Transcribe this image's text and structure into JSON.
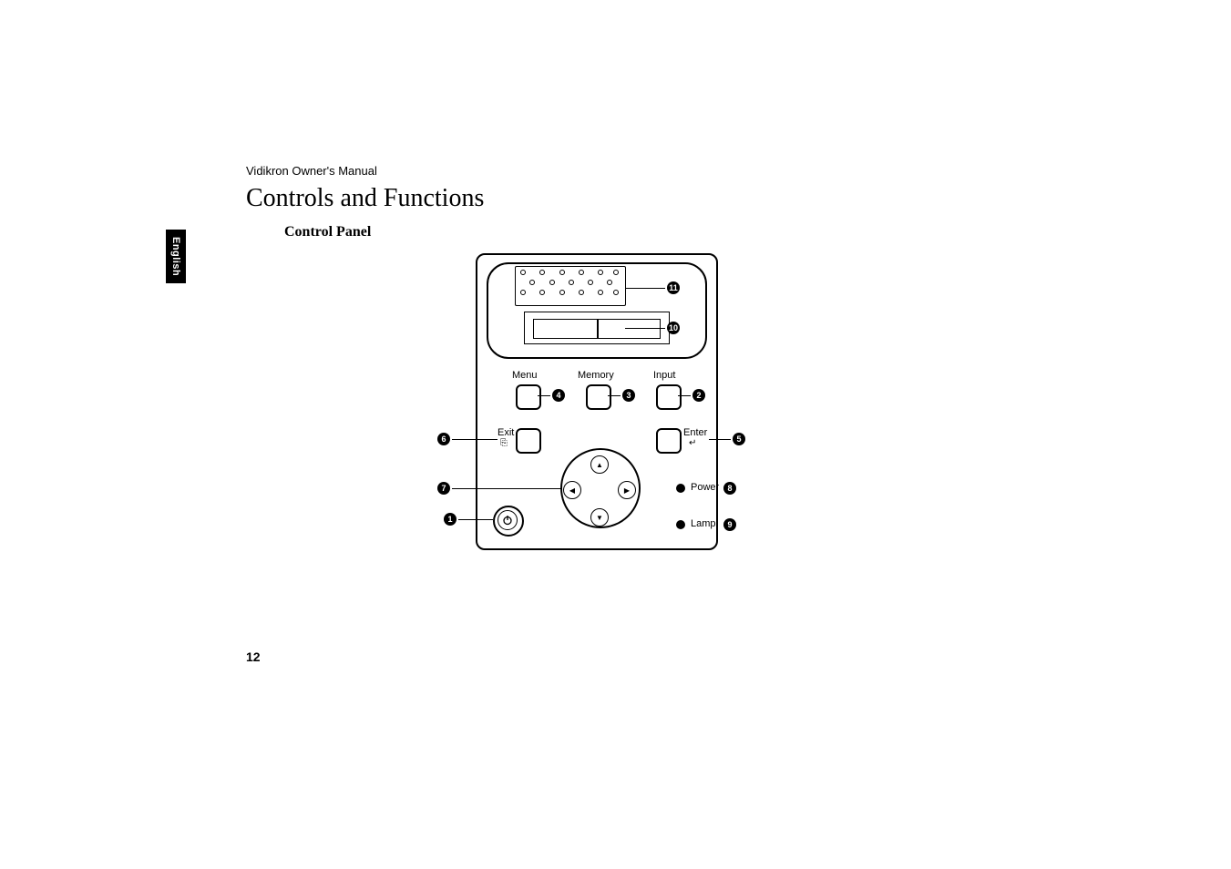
{
  "doc": {
    "header": "Vidikron Owner's Manual",
    "section_title": "Controls and Functions",
    "subsection_title": "Control Panel",
    "language_tab": "English",
    "page_number": "12"
  },
  "panel": {
    "buttons": {
      "menu": "Menu",
      "memory": "Memory",
      "input": "Input",
      "exit": "Exit",
      "enter": "Enter"
    },
    "indicators": {
      "power": "Power",
      "lamp": "Lamp"
    }
  },
  "callouts": {
    "c1": "1",
    "c2": "2",
    "c3": "3",
    "c4": "4",
    "c5": "5",
    "c6": "6",
    "c7": "7",
    "c8": "8",
    "c9": "9",
    "c10": "10",
    "c11": "11"
  }
}
